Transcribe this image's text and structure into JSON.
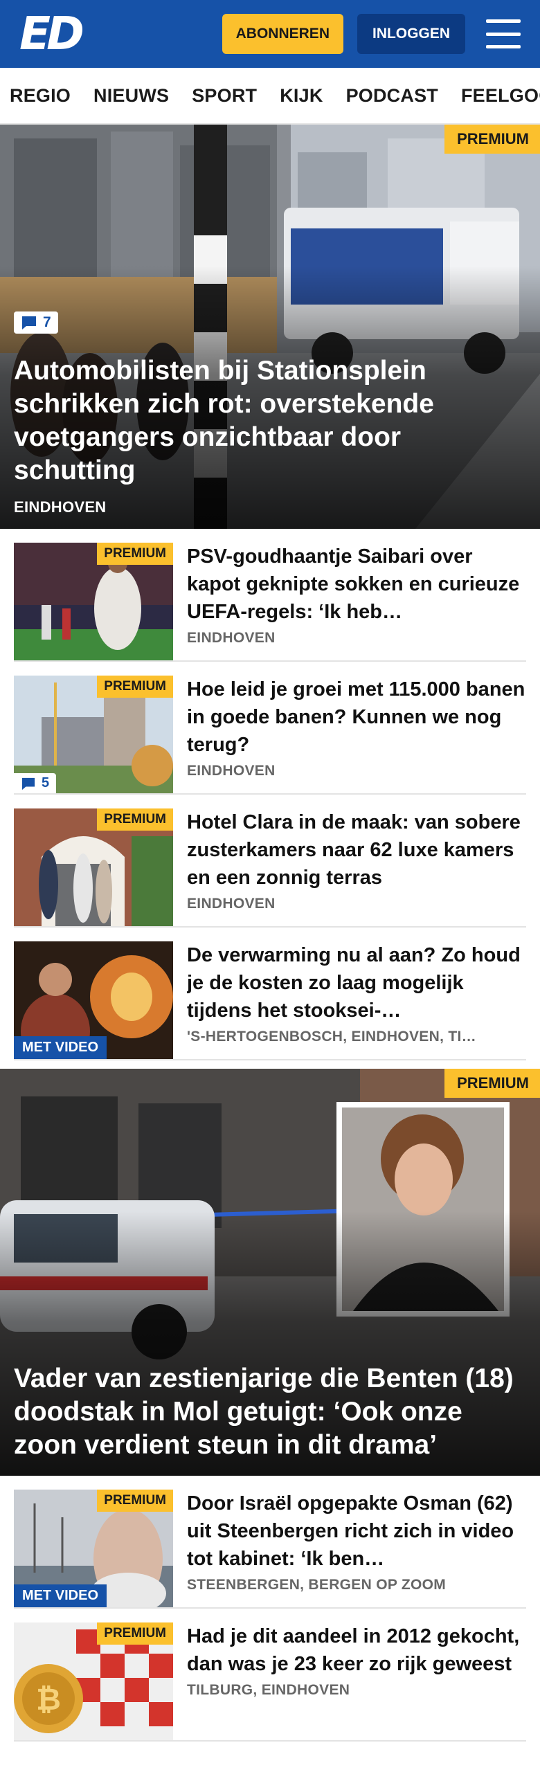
{
  "header": {
    "logo": "ED",
    "subscribe_label": "ABONNEREN",
    "login_label": "INLOGGEN"
  },
  "nav": {
    "items": [
      "REGIO",
      "NIEUWS",
      "SPORT",
      "KIJK",
      "PODCAST",
      "FEELGOOD"
    ]
  },
  "labels": {
    "premium": "PREMIUM",
    "video": "MET VIDEO"
  },
  "hero1": {
    "comments": "7",
    "title": "Automobilisten bij Stationsplein schrikken zich rot: overstekende voetgangers onzichtbaar door schutting",
    "location": "EINDHOVEN"
  },
  "articles1": [
    {
      "title": "PSV-goudhaantje Saibari over kapot geknipte sokken en curieuze UEFA-regels: ‘Ik heb…",
      "location": "EINDHOVEN"
    },
    {
      "title": "Hoe leid je groei met 115.000 banen in goede banen? Kunnen we nog terug?",
      "location": "EINDHOVEN",
      "comments": "5"
    },
    {
      "title": "Hotel Clara in de maak: van sobere zusterkamers naar 62 luxe kamers en een zonnig terras",
      "location": "EINDHOVEN"
    },
    {
      "title": "De verwarming nu al aan? Zo houd je de kosten zo laag mogelijk tijdens het stooksei-…",
      "location": "'S-HERTOGENBOSCH, EINDHOVEN, TI…"
    }
  ],
  "hero2": {
    "title": "Vader van zestienjarige die Benten (18) doodstak in Mol getuigt: ‘Ook onze zoon verdient steun in dit drama’"
  },
  "articles2": [
    {
      "title": "Door Israël opgepakte Osman (62) uit Steenbergen richt zich in video tot kabinet: ‘Ik ben…",
      "location": "STEENBERGEN, BERGEN OP ZOOM"
    },
    {
      "title": "Had je dit aandeel in 2012 gekocht, dan was je 23 keer zo rijk geweest",
      "location": "TILBURG, EINDHOVEN"
    }
  ],
  "colors": {
    "brand": "#1652a8",
    "premium": "#fbc02d"
  }
}
